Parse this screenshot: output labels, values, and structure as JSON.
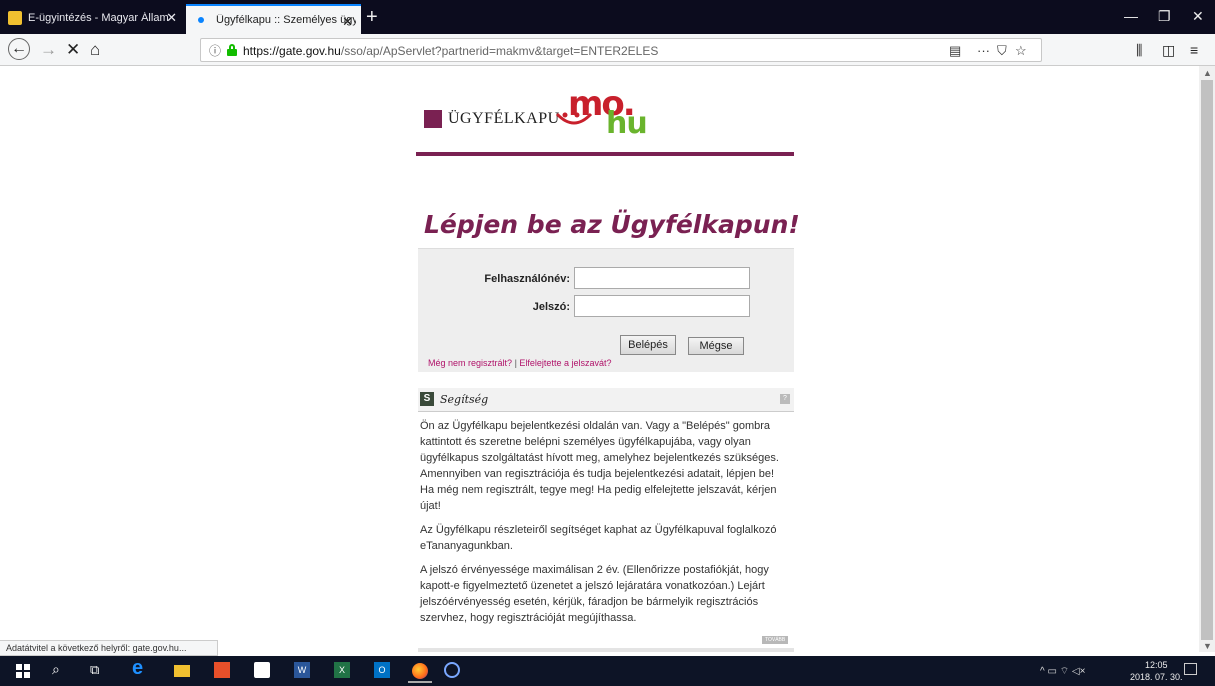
{
  "browser": {
    "tabs": [
      {
        "title": "E-ügyintézés - Magyar Államk"
      },
      {
        "title": "Ügyfélkapu :: Személyes ügyfé"
      }
    ],
    "url_host": "https://gate.gov.hu",
    "url_path": "/sso/ap/ApServlet?partnerid=makmv&target=ENTER2ELES",
    "status_text": "Adatátvitel a következő helyről: gate.gov.hu..."
  },
  "page": {
    "logo_text": "ÜGYFÉLKAPU",
    "logo_mo": "mo.",
    "logo_hu": "hu",
    "heading": "Lépjen be az Ügyfélkapun!",
    "login": {
      "username_label": "Felhasználónév:",
      "password_label": "Jelszó:",
      "login_button": "Belépés",
      "cancel_button": "Mégse",
      "register_link": "Még nem regisztrált?",
      "separator": "|",
      "forgot_link": "Elfelejtette a jelszavát?"
    },
    "help": {
      "icon_letter": "S",
      "title": "Segítség",
      "help_icon": "?",
      "paragraphs": [
        "Ön az Ügyfélkapu bejelentkezési oldalán van. Vagy a \"Belépés\" gombra kattintott és szeretne belépni személyes ügyfélkapujába, vagy olyan ügyfélkapus szolgáltatást hívott meg, amelyhez bejelentkezés szükséges. Amennyiben van regisztrációja és tudja bejelentkezési adatait, lépjen be! Ha még nem regisztrált, tegye meg! Ha pedig elfelejtette jelszavát, kérjen újat!",
        "Az Ügyfélkapu részleteiről segítséget kaphat az Ügyfélkapuval foglalkozó eTananyagunkban.",
        "A jelszó érvényessége maximálisan 2 év. (Ellenőrizze postafiókját, hogy kapott-e figyelmeztető üzenetet a jelszó lejáratára vonatkozóan.) Lejárt jelszóérvényesség esetén, kérjük, fáradjon be bármelyik regisztrációs szervhez, hogy regisztrációját megújíthassa."
      ],
      "more_button": "TOVÁBB"
    }
  },
  "taskbar": {
    "time": "12:05",
    "date": "2018. 07. 30."
  },
  "colors": {
    "brand": "#7a2152",
    "link": "#b0136a"
  }
}
